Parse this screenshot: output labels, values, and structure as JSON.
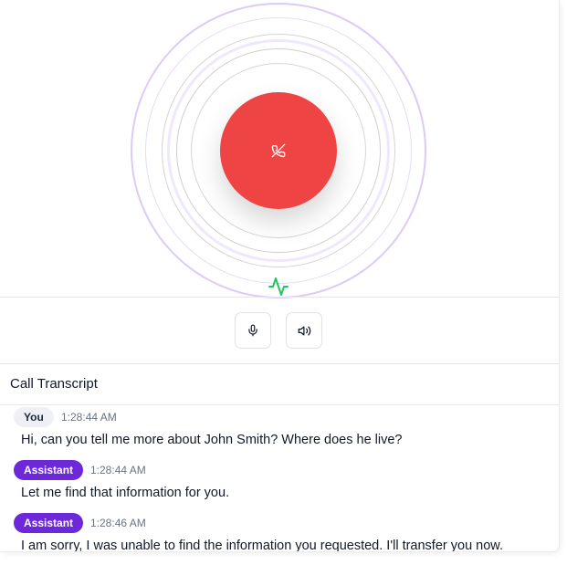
{
  "call": {
    "end_call_icon": "phone-off-icon",
    "activity_icon": "activity-icon",
    "accent_color": "#ef4444",
    "activity_color": "#22c55e",
    "ring_color": "#d9c8f5"
  },
  "controls": {
    "mic_icon": "mic-icon",
    "speaker_icon": "volume-icon"
  },
  "transcript": {
    "title": "Call Transcript",
    "messages": [
      {
        "role": "You",
        "time": "1:28:44 AM",
        "text": "Hi, can you tell me more about John Smith? Where does he live?"
      },
      {
        "role": "Assistant",
        "time": "1:28:44 AM",
        "text": "Let me find that information for you."
      },
      {
        "role": "Assistant",
        "time": "1:28:46 AM",
        "text": "I am sorry, I was unable to find the information you requested. I'll transfer you now."
      }
    ]
  },
  "colors": {
    "assistant_badge": "#6d28d9",
    "user_badge": "#eef0f5"
  }
}
